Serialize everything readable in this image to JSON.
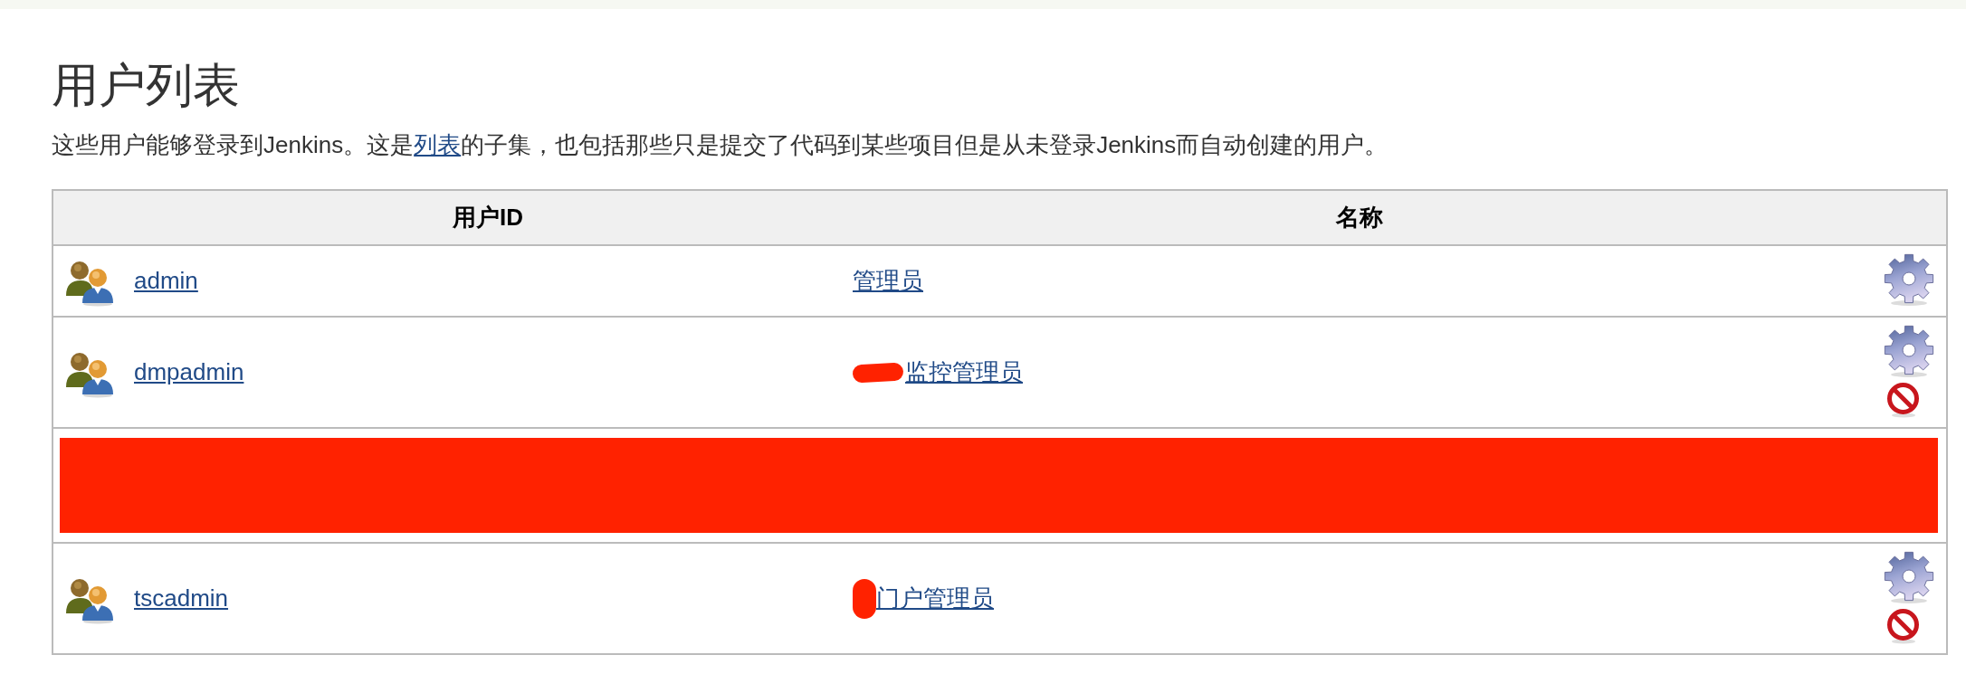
{
  "page_title": "用户列表",
  "description": {
    "text_before": "这些用户能够登录到Jenkins。这是",
    "link": "列表",
    "text_after": "的子集，也包括那些只是提交了代码到某些项目但是从未登录Jenkins而自动创建的用户。"
  },
  "table": {
    "columns": [
      {
        "label": "用户ID"
      },
      {
        "label": "名称"
      }
    ],
    "rows": [
      {
        "kind": "user",
        "user_id": "admin",
        "name": "管理员",
        "actions": [
          {
            "kind": "configure"
          }
        ]
      },
      {
        "kind": "user",
        "user_id": "dmpadmin",
        "name": "监控管理员",
        "redaction_mark": {
          "kind": "smear"
        },
        "actions": [
          {
            "kind": "configure"
          },
          {
            "kind": "delete"
          }
        ]
      },
      {
        "kind": "redacted"
      },
      {
        "kind": "user",
        "user_id": "tscadmin",
        "name": "门户管理员",
        "redaction_mark": {
          "kind": "blot"
        },
        "actions": [
          {
            "kind": "configure"
          },
          {
            "kind": "delete"
          }
        ]
      }
    ]
  }
}
